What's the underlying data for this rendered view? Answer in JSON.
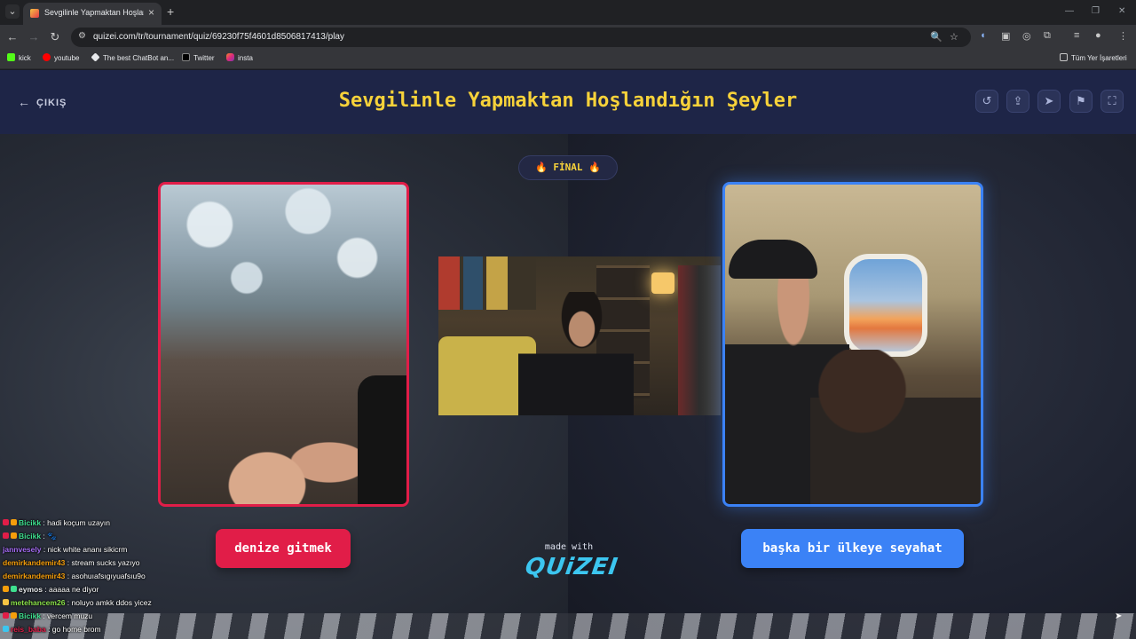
{
  "browser": {
    "tab_title": "Sevgilinle Yapmaktan Hoşlandığ",
    "tab_close": "×",
    "new_tab": "+",
    "url": "quizei.com/tr/tournament/quiz/69230f75f4601d8506817413/play",
    "bookmarks": [
      {
        "label": "kick",
        "color": "#53fc18"
      },
      {
        "label": "youtube",
        "color": "#ff0000"
      },
      {
        "label": "The best ChatBot an...",
        "color": "#e8eaed"
      },
      {
        "label": "Twitter",
        "color": "#e8eaed"
      },
      {
        "label": "insta",
        "color": "#e1306c"
      }
    ],
    "all_bookmarks": "Tüm Yer İşaretleri"
  },
  "header": {
    "exit_label": "ÇIKIŞ",
    "title": "Sevgilinle Yapmaktan Hoşlandığın Şeyler"
  },
  "round": {
    "label": "🔥 FİNAL 🔥"
  },
  "choices": {
    "left": "denize gitmek",
    "right": "başka bir ülkeye seyahat"
  },
  "branding": {
    "made_with": "made with",
    "logo": "QUiZEI"
  },
  "colors": {
    "accent_yellow": "#f7d23a",
    "left_red": "#e11d48",
    "right_blue": "#3b82f6",
    "header_bg": "#1e2547"
  },
  "chat": [
    {
      "user": "Bicikk",
      "color": "#3ee08f",
      "message": ": hadi koçum uzayın"
    },
    {
      "user": "Bicikk",
      "color": "#3ee08f",
      "message": ": 🐾"
    },
    {
      "user": "jannvesely",
      "color": "#a56cf5",
      "message": ": nick white ananı sikicrm"
    },
    {
      "user": "demirkandemir43",
      "color": "#f59e0b",
      "message": ": stream sucks yazıyo"
    },
    {
      "user": "demirkandemir43",
      "color": "#f59e0b",
      "message": ": asohuıafsıgıyuafsıu9o"
    },
    {
      "user": "eymos",
      "color": "#e8eaed",
      "message": ": aaaaa ne diyor"
    },
    {
      "user": "metehancem26",
      "color": "#8be34a",
      "message": ": noluyo amkk ddos yicez"
    },
    {
      "user": "Bicikk",
      "color": "#3ee08f",
      "message": ": vercem muzu"
    },
    {
      "user": "reis_baba",
      "color": "#e11d48",
      "message": ": go home brom"
    }
  ]
}
